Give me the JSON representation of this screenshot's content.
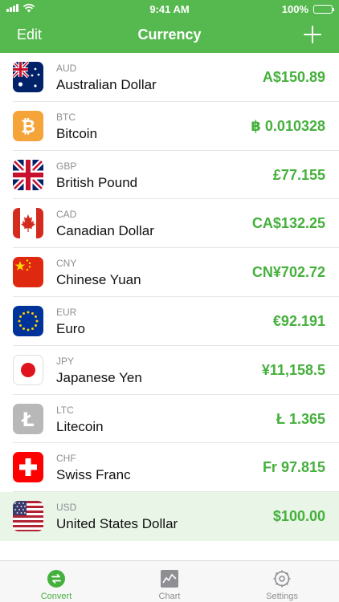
{
  "status": {
    "time": "9:41 AM",
    "battery": "100%"
  },
  "nav": {
    "edit_label": "Edit",
    "title": "Currency"
  },
  "currencies": [
    {
      "code": "AUD",
      "name": "Australian Dollar",
      "amount": "A$150.89"
    },
    {
      "code": "BTC",
      "name": "Bitcoin",
      "amount": "฿ 0.010328"
    },
    {
      "code": "GBP",
      "name": "British Pound",
      "amount": "£77.155"
    },
    {
      "code": "CAD",
      "name": "Canadian Dollar",
      "amount": "CA$132.25"
    },
    {
      "code": "CNY",
      "name": "Chinese Yuan",
      "amount": "CN¥702.72"
    },
    {
      "code": "EUR",
      "name": "Euro",
      "amount": "€92.191"
    },
    {
      "code": "JPY",
      "name": "Japanese Yen",
      "amount": "¥11,158.5"
    },
    {
      "code": "LTC",
      "name": "Litecoin",
      "amount": "Ł 1.365"
    },
    {
      "code": "CHF",
      "name": "Swiss Franc",
      "amount": "Fr 97.815"
    },
    {
      "code": "USD",
      "name": "United States Dollar",
      "amount": "$100.00"
    }
  ],
  "tabs": [
    {
      "label": "Convert",
      "icon": "convert-icon"
    },
    {
      "label": "Chart",
      "icon": "chart-icon"
    },
    {
      "label": "Settings",
      "icon": "settings-icon"
    }
  ],
  "colors": {
    "accent": "#56b94f",
    "amount": "#46b03d",
    "selected_row": "#e9f5e7"
  }
}
